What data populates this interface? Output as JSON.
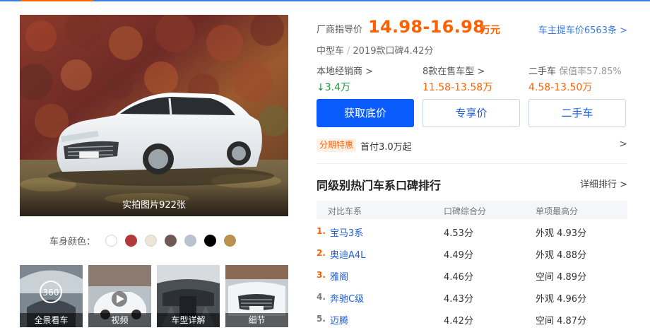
{
  "gallery": {
    "photo_count": "实拍图片922张",
    "color_label": "车身颜色：",
    "colors": [
      "#ffffff",
      "#b23a3a",
      "#eee4d8",
      "#6d5a55",
      "#b9c2cf",
      "#000000",
      "#b8924e"
    ],
    "thumbnails": [
      {
        "label": "全景看车",
        "badge": "360"
      },
      {
        "label": "视频"
      },
      {
        "label": "车型详解"
      },
      {
        "label": "细节"
      }
    ]
  },
  "price": {
    "label": "厂商指导价",
    "value": "14.98-16.98",
    "unit": "万元",
    "owner_link": "车主提车价6563条 >"
  },
  "meta": {
    "class": "中型车",
    "rating": "2019款口碑4.42分"
  },
  "stats": {
    "dealer": {
      "label": "本地经销商 >",
      "value": "3.4万",
      "arrow": "↓"
    },
    "models": {
      "label": "8款在售车型 >",
      "value": "11.58-13.58万"
    },
    "used": {
      "label": "二手车",
      "sub": "保值率57.85%",
      "value": "4.58-13.50万"
    }
  },
  "buttons": {
    "floor_price": "获取底价",
    "exclusive": "专享价",
    "used_car": "二手车"
  },
  "promo": {
    "tag": "分期特惠",
    "text": "首付3.0万起",
    "arrow": ">"
  },
  "ranking": {
    "title": "同级别热门车系口碑排行",
    "more": "详细排行 >",
    "columns": [
      "对比车系",
      "口碑综合分",
      "单项最高分"
    ],
    "rows": [
      {
        "rank": "1.",
        "name": "宝马3系",
        "score": "4.53分",
        "best": "外观 4.93分"
      },
      {
        "rank": "2.",
        "name": "奥迪A4L",
        "score": "4.49分",
        "best": "外观 4.88分"
      },
      {
        "rank": "3.",
        "name": "雅阁",
        "score": "4.46分",
        "best": "空间 4.89分"
      },
      {
        "rank": "4.",
        "name": "奔驰C级",
        "score": "4.43分",
        "best": "外观 4.96分"
      },
      {
        "rank": "5.",
        "name": "迈腾",
        "score": "4.42分",
        "best": "空间 4.87分"
      }
    ]
  }
}
